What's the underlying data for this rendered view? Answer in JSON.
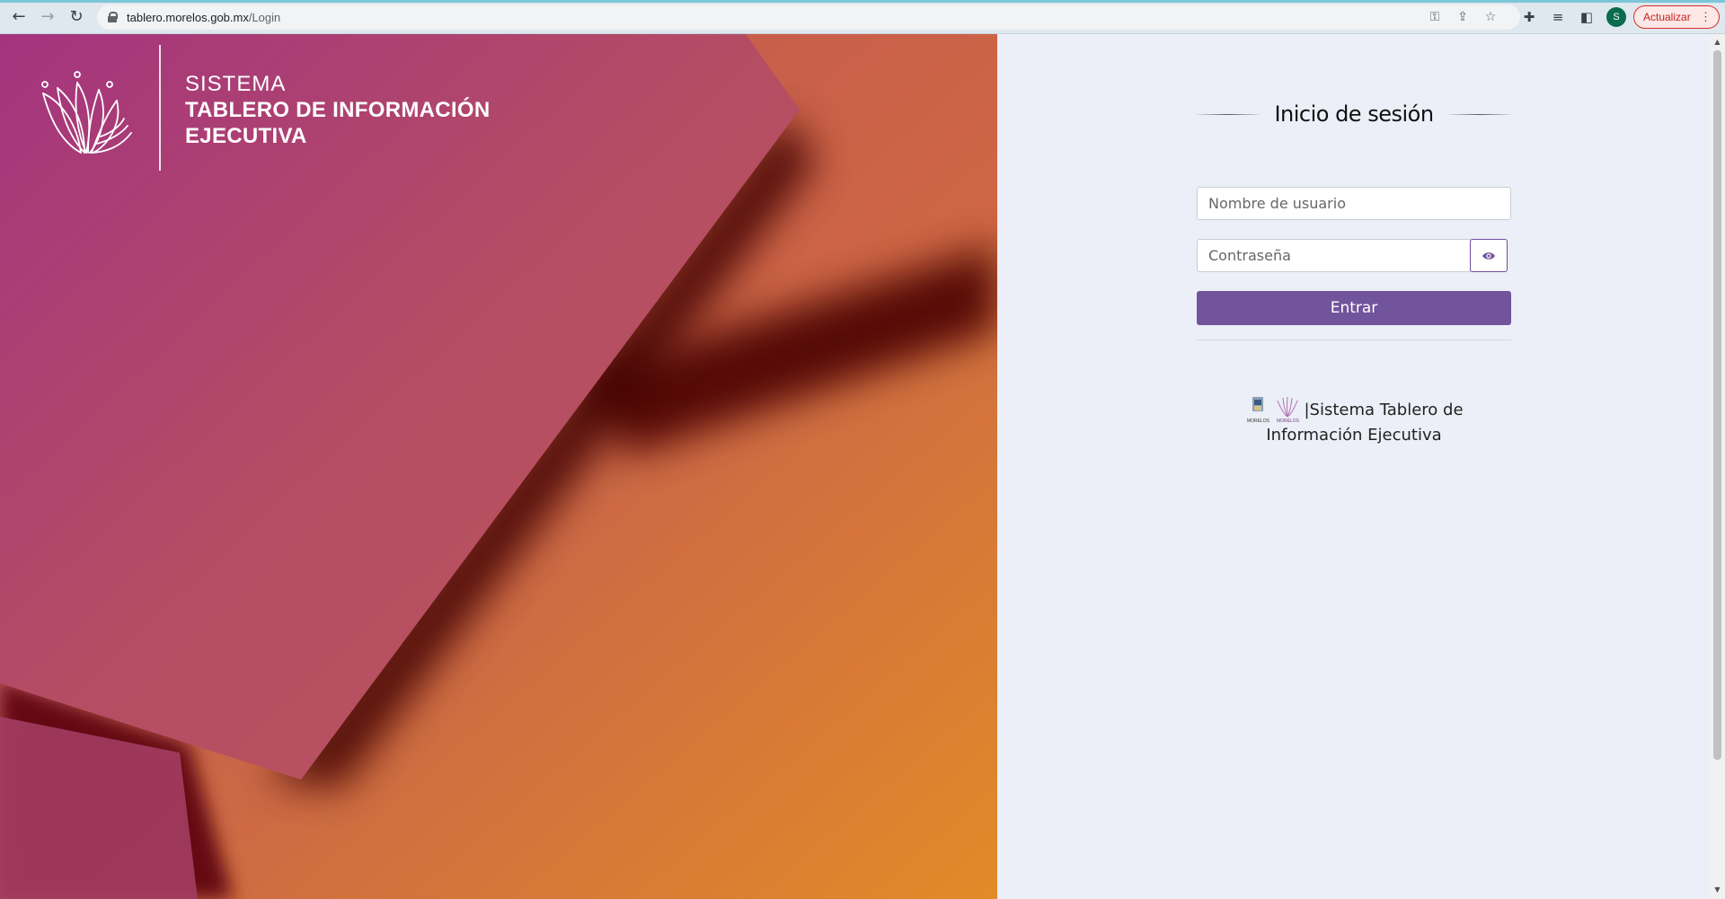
{
  "browser": {
    "url_host": "tablero.morelos.gob.mx",
    "url_path": "/Login",
    "avatar_letter": "S",
    "update_label": "Actualizar",
    "icons": [
      "back-arrow-icon",
      "forward-arrow-icon",
      "reload-icon",
      "lock-icon",
      "key-icon",
      "share-icon",
      "star-icon",
      "extensions-icon",
      "media-queue-icon",
      "side-panel-icon",
      "menu-dots-icon"
    ]
  },
  "hero": {
    "line1": "SISTEMA",
    "line2": "TABLERO DE INFORMACIÓN",
    "line3": "EJECUTIVA",
    "colors": {
      "magenta": "#a7338e",
      "coral": "#c8634c",
      "orange": "#e0862c",
      "dark": "#500005"
    }
  },
  "login": {
    "title": "Inicio de sesión",
    "username_placeholder": "Nombre de usuario",
    "password_placeholder": "Contraseña",
    "submit_label": "Entrar",
    "accent": "#71549c"
  },
  "footer": {
    "text_line1": "|Sistema Tablero de",
    "text_line2": "Información Ejecutiva",
    "logo_caption1": "MORELOS",
    "logo_caption2": "MORELOS"
  }
}
